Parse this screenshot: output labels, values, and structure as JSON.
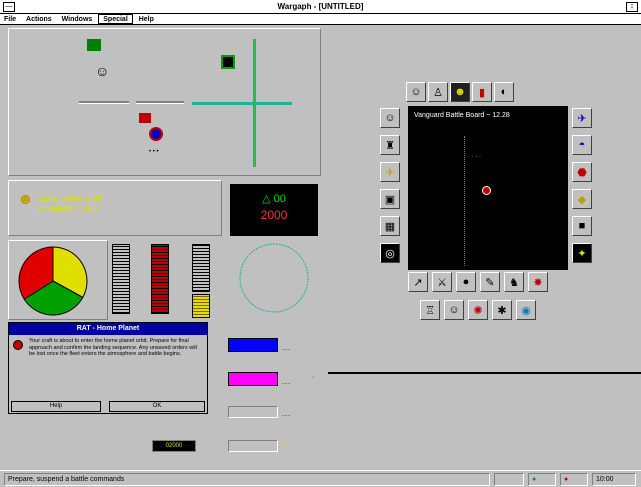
{
  "window": {
    "title": "Wargaph - [UNTITLED]",
    "sys_menu_glyph": "—",
    "maximize_glyph": "↕"
  },
  "menu": {
    "items": [
      "File",
      "Actions",
      "Windows",
      "Special",
      "Help"
    ]
  },
  "unit_info": {
    "line1": "Lunar Strike Craft",
    "line2": "Population: 100k"
  },
  "score_box": {
    "line1": "△ 00",
    "line2": "2000"
  },
  "tactical": {
    "title": "Vanguard Battle Board ~ 12.28"
  },
  "dialog": {
    "title": "RAT - Home Planet",
    "body": "Your craft is about to enter the home planet orbit. Prepare for final approach and confirm the landing sequence. Any unsaved orders will be lost once the fleet enters the atmosphere and battle begins.",
    "help_label": "Help",
    "ok_label": "OK"
  },
  "meters": [
    {
      "label": "......",
      "color": "#0000ff",
      "fill": 1.0
    },
    {
      "label": "......",
      "color": "#ff00ff",
      "fill": 1.0
    },
    {
      "label": "......",
      "color": "#c0c0c0",
      "fill": 0.0
    },
    {
      "label": "<",
      "color": "#c0c0c0",
      "fill": 0.0
    }
  ],
  "counter": {
    "value": "02000"
  },
  "status": {
    "text": "Prepare, suspend a battle commands",
    "time": "10:00"
  },
  "icons": {
    "top_row": [
      "commander-icon",
      "soldier-icon",
      "portrait-icon",
      "flags-icon",
      "tank-icon"
    ],
    "left_col": [
      "pilot-icon",
      "team-icon",
      "ship-icon",
      "truck-icon",
      "map-icon",
      "radar-icon"
    ],
    "right_col": [
      "jet-icon",
      "ufo-icon",
      "stop-icon",
      "warning-icon",
      "square-icon",
      "star-icon"
    ],
    "bottom_row1": [
      "knife-icon",
      "sword-icon",
      "bomb-icon",
      "torch-icon",
      "crew-icon",
      "shield-icon"
    ],
    "bottom_row2": [
      "castle-icon",
      "doctor-icon",
      "explosion-icon",
      "spider-icon",
      "globe-icon"
    ]
  },
  "pie": {
    "segments": [
      {
        "label": "yellow",
        "color": "#e0e000",
        "value": 0.33
      },
      {
        "label": "green",
        "color": "#00a000",
        "value": 0.33
      },
      {
        "label": "red",
        "color": "#e00000",
        "value": 0.34
      }
    ]
  }
}
